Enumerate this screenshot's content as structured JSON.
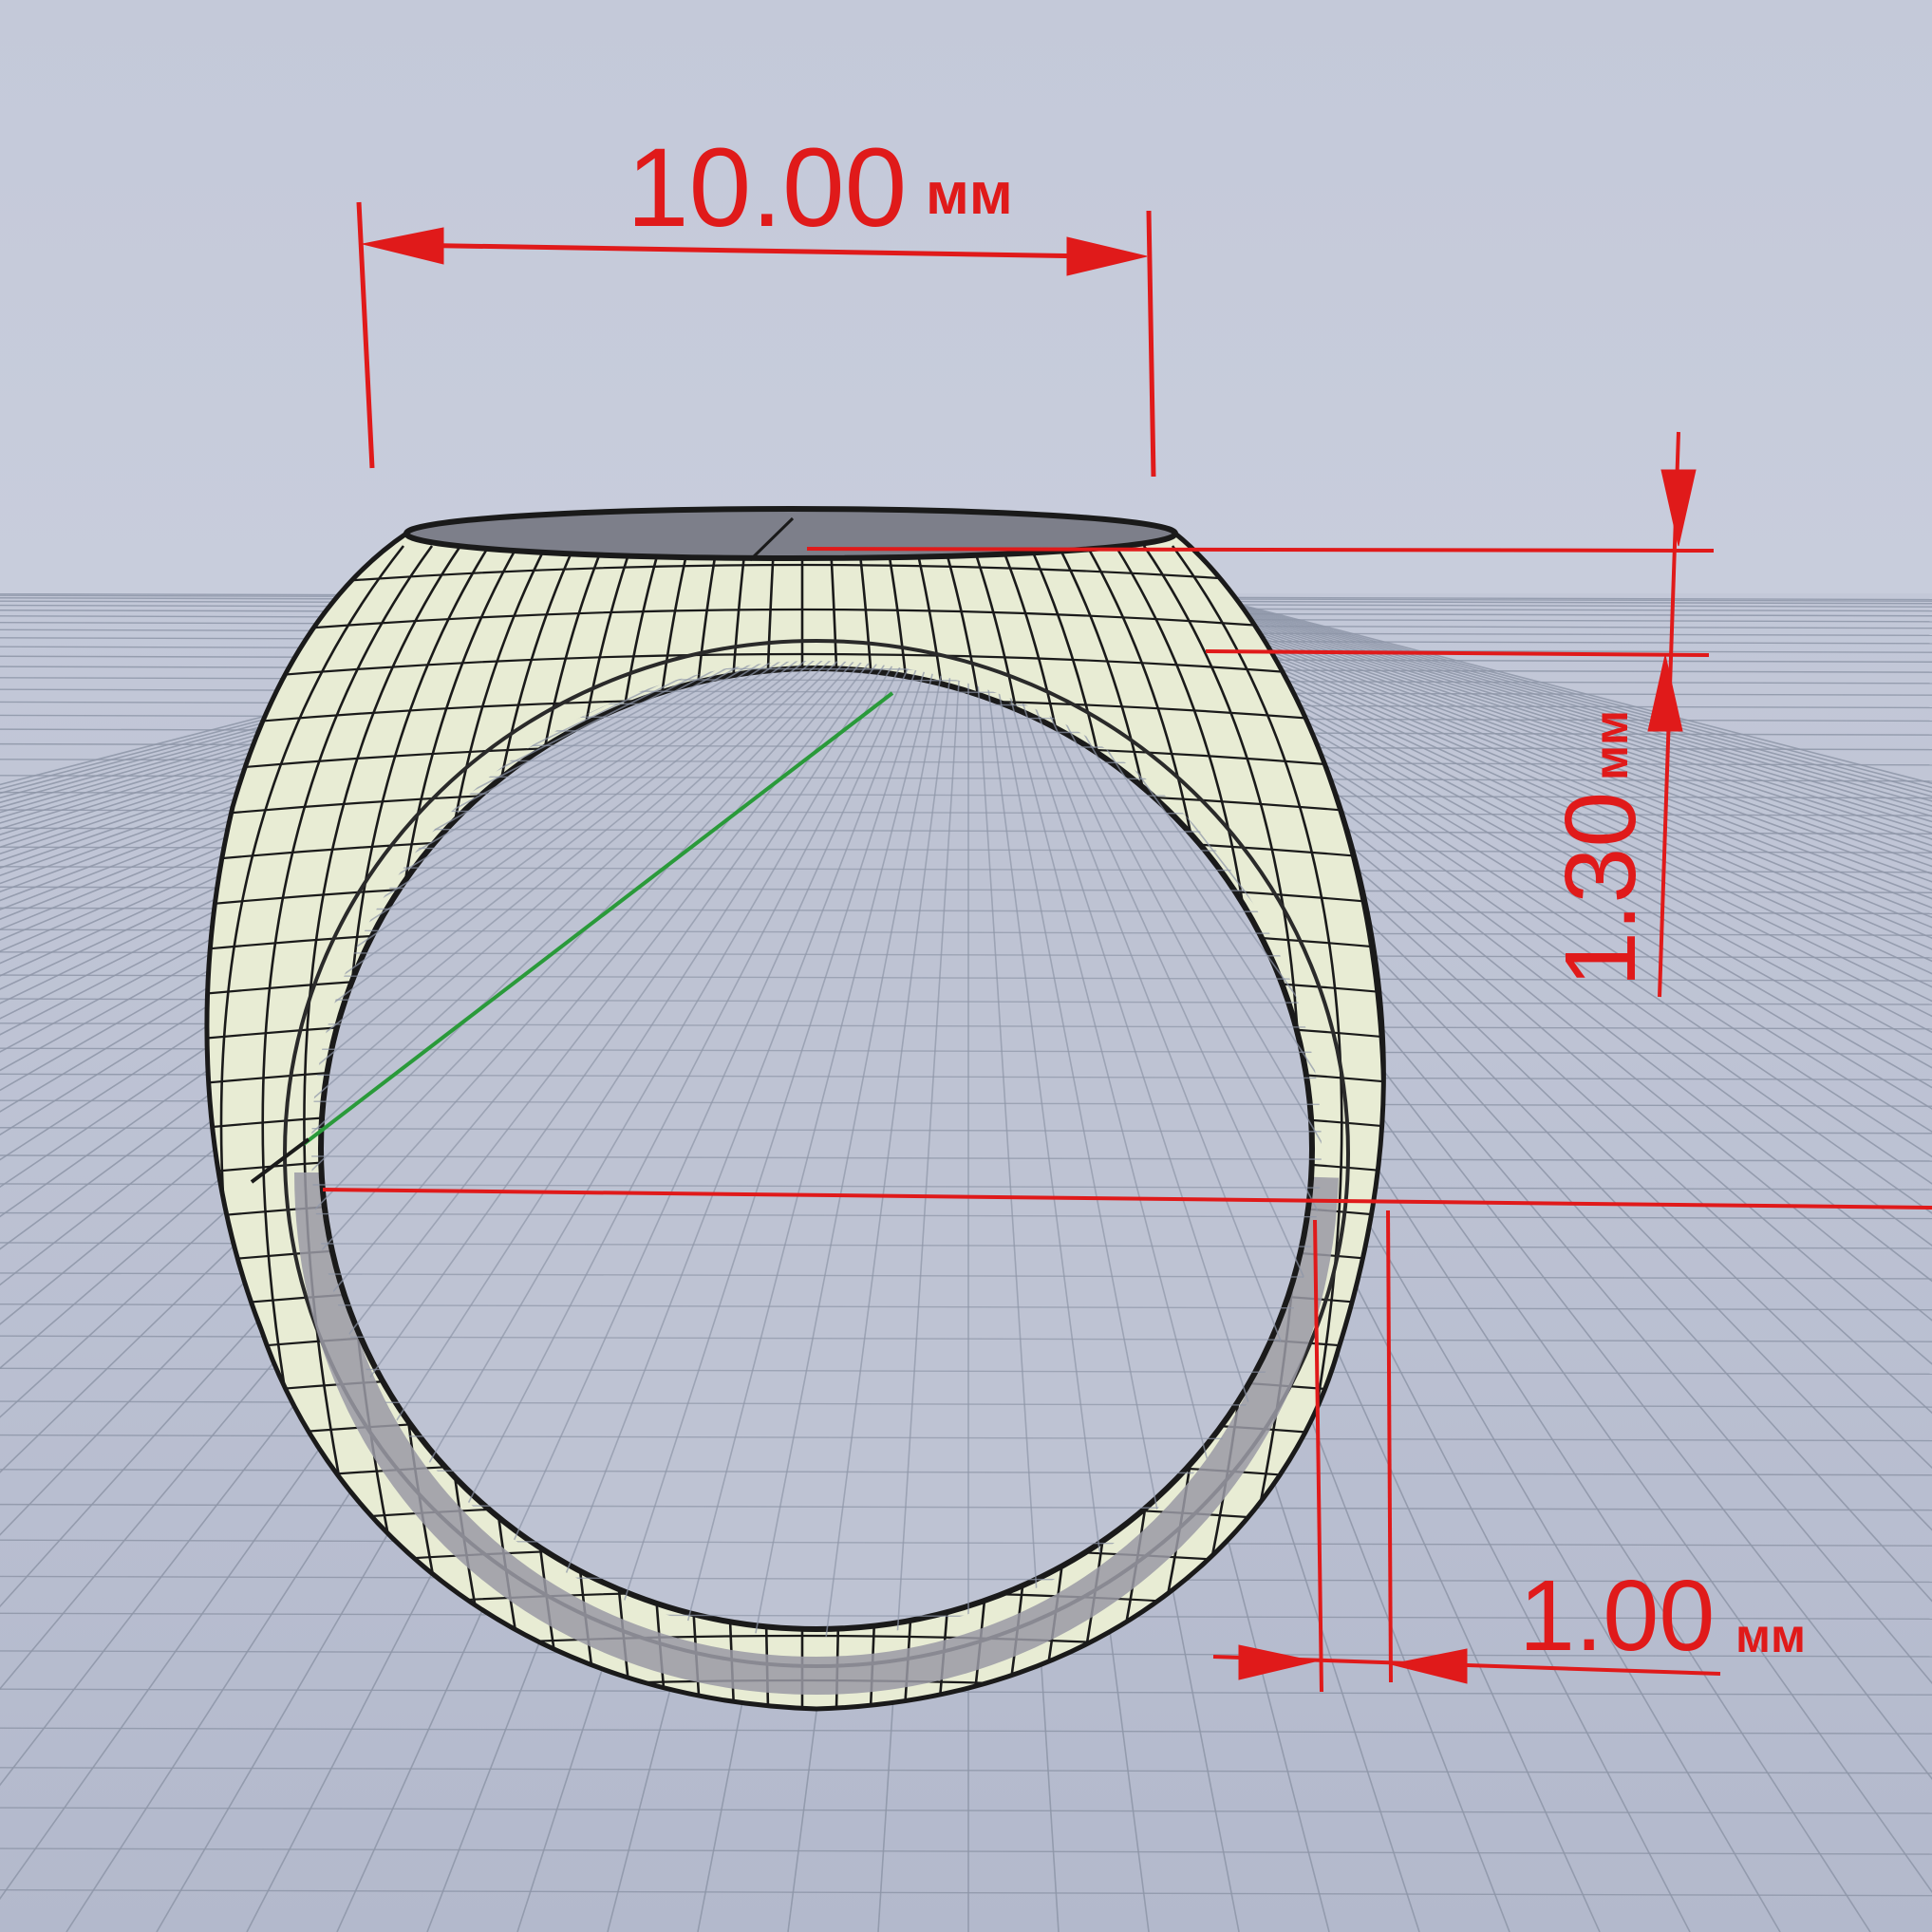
{
  "dimensions": {
    "width": {
      "value": "10.00",
      "unit": "мм"
    },
    "top_thickness": {
      "value": "1.30",
      "unit": "мм"
    },
    "shank_thickness": {
      "value": "1.00",
      "unit": "мм"
    }
  },
  "colors": {
    "dimension": "#e01a1a",
    "ring_fill": "#e8ecd4",
    "mesh_line": "#1a1a1a",
    "background": "#c4c9d9",
    "grid": "#8e96a8",
    "axis_green": "#2a9a3a"
  }
}
